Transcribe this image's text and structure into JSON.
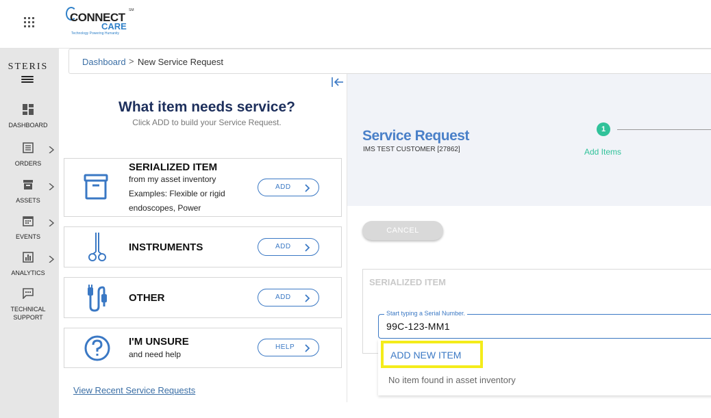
{
  "app": {
    "logo_word1": "CONNECT",
    "logo_word2": "CARE",
    "logo_tagline": "Technology Powering Humanity",
    "logo_sm": "SM",
    "vendor": "STERIS"
  },
  "sidebar": {
    "items": [
      {
        "label": "DASHBOARD",
        "icon": "dashboard-icon"
      },
      {
        "label": "ORDERS",
        "icon": "orders-icon"
      },
      {
        "label": "ASSETS",
        "icon": "assets-icon"
      },
      {
        "label": "EVENTS",
        "icon": "calendar-icon"
      },
      {
        "label": "ANALYTICS",
        "icon": "analytics-icon"
      },
      {
        "label": "TECHNICAL SUPPORT",
        "icon": "chat-icon"
      }
    ]
  },
  "breadcrumb": {
    "link": "Dashboard",
    "separator": ">",
    "current": "New Service Request"
  },
  "left": {
    "title": "What item needs service?",
    "subtitle": "Click ADD to build your Service Request.",
    "cards": [
      {
        "title": "SERIALIZED ITEM",
        "desc1": "from my asset inventory",
        "desc2": "Examples: Flexible or rigid",
        "desc3": "endoscopes, Power",
        "button": "ADD"
      },
      {
        "title": "INSTRUMENTS",
        "button": "ADD"
      },
      {
        "title": "OTHER",
        "button": "ADD"
      },
      {
        "title": "I'M UNSURE",
        "desc1": "and need help",
        "button": "HELP"
      }
    ],
    "recent_link": "View Recent Service Requests"
  },
  "right": {
    "title": "Service Request",
    "customer": "IMS TEST CUSTOMER [27862]",
    "step_number": "1",
    "step_label": "Add Items",
    "cancel": "CANCEL",
    "section_title": "SERIALIZED ITEM",
    "field_label": "Start typing a Serial Number.",
    "field_value": "99C-123-MM1",
    "add_new": "ADD NEW ITEM",
    "no_item": "No item found in asset inventory"
  },
  "colors": {
    "accent": "#3a78c4",
    "heading": "#1d2f5c",
    "step": "#31c29a",
    "highlight": "#f4ec1a"
  }
}
